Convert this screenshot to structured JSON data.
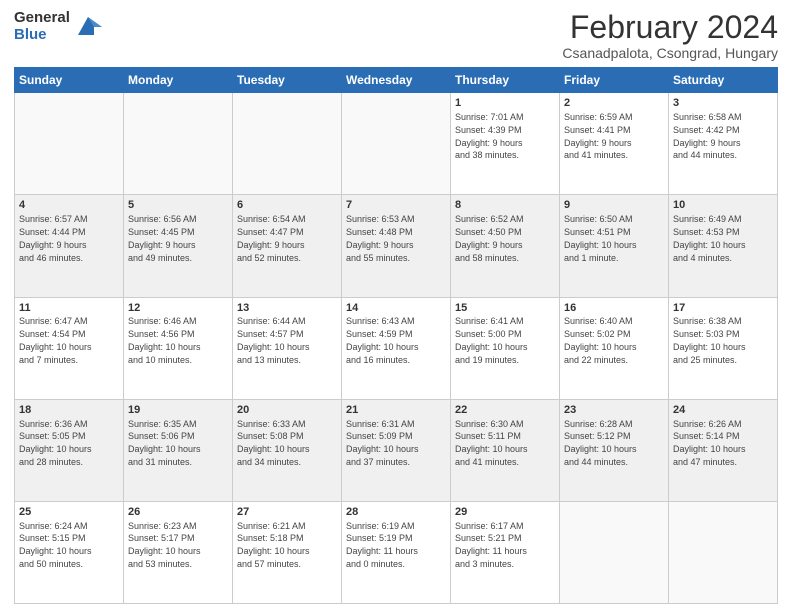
{
  "logo": {
    "general": "General",
    "blue": "Blue"
  },
  "header": {
    "month": "February 2024",
    "location": "Csanadpalota, Csongrad, Hungary"
  },
  "days_of_week": [
    "Sunday",
    "Monday",
    "Tuesday",
    "Wednesday",
    "Thursday",
    "Friday",
    "Saturday"
  ],
  "weeks": [
    [
      {
        "num": "",
        "info": ""
      },
      {
        "num": "",
        "info": ""
      },
      {
        "num": "",
        "info": ""
      },
      {
        "num": "",
        "info": ""
      },
      {
        "num": "1",
        "info": "Sunrise: 7:01 AM\nSunset: 4:39 PM\nDaylight: 9 hours\nand 38 minutes."
      },
      {
        "num": "2",
        "info": "Sunrise: 6:59 AM\nSunset: 4:41 PM\nDaylight: 9 hours\nand 41 minutes."
      },
      {
        "num": "3",
        "info": "Sunrise: 6:58 AM\nSunset: 4:42 PM\nDaylight: 9 hours\nand 44 minutes."
      }
    ],
    [
      {
        "num": "4",
        "info": "Sunrise: 6:57 AM\nSunset: 4:44 PM\nDaylight: 9 hours\nand 46 minutes."
      },
      {
        "num": "5",
        "info": "Sunrise: 6:56 AM\nSunset: 4:45 PM\nDaylight: 9 hours\nand 49 minutes."
      },
      {
        "num": "6",
        "info": "Sunrise: 6:54 AM\nSunset: 4:47 PM\nDaylight: 9 hours\nand 52 minutes."
      },
      {
        "num": "7",
        "info": "Sunrise: 6:53 AM\nSunset: 4:48 PM\nDaylight: 9 hours\nand 55 minutes."
      },
      {
        "num": "8",
        "info": "Sunrise: 6:52 AM\nSunset: 4:50 PM\nDaylight: 9 hours\nand 58 minutes."
      },
      {
        "num": "9",
        "info": "Sunrise: 6:50 AM\nSunset: 4:51 PM\nDaylight: 10 hours\nand 1 minute."
      },
      {
        "num": "10",
        "info": "Sunrise: 6:49 AM\nSunset: 4:53 PM\nDaylight: 10 hours\nand 4 minutes."
      }
    ],
    [
      {
        "num": "11",
        "info": "Sunrise: 6:47 AM\nSunset: 4:54 PM\nDaylight: 10 hours\nand 7 minutes."
      },
      {
        "num": "12",
        "info": "Sunrise: 6:46 AM\nSunset: 4:56 PM\nDaylight: 10 hours\nand 10 minutes."
      },
      {
        "num": "13",
        "info": "Sunrise: 6:44 AM\nSunset: 4:57 PM\nDaylight: 10 hours\nand 13 minutes."
      },
      {
        "num": "14",
        "info": "Sunrise: 6:43 AM\nSunset: 4:59 PM\nDaylight: 10 hours\nand 16 minutes."
      },
      {
        "num": "15",
        "info": "Sunrise: 6:41 AM\nSunset: 5:00 PM\nDaylight: 10 hours\nand 19 minutes."
      },
      {
        "num": "16",
        "info": "Sunrise: 6:40 AM\nSunset: 5:02 PM\nDaylight: 10 hours\nand 22 minutes."
      },
      {
        "num": "17",
        "info": "Sunrise: 6:38 AM\nSunset: 5:03 PM\nDaylight: 10 hours\nand 25 minutes."
      }
    ],
    [
      {
        "num": "18",
        "info": "Sunrise: 6:36 AM\nSunset: 5:05 PM\nDaylight: 10 hours\nand 28 minutes."
      },
      {
        "num": "19",
        "info": "Sunrise: 6:35 AM\nSunset: 5:06 PM\nDaylight: 10 hours\nand 31 minutes."
      },
      {
        "num": "20",
        "info": "Sunrise: 6:33 AM\nSunset: 5:08 PM\nDaylight: 10 hours\nand 34 minutes."
      },
      {
        "num": "21",
        "info": "Sunrise: 6:31 AM\nSunset: 5:09 PM\nDaylight: 10 hours\nand 37 minutes."
      },
      {
        "num": "22",
        "info": "Sunrise: 6:30 AM\nSunset: 5:11 PM\nDaylight: 10 hours\nand 41 minutes."
      },
      {
        "num": "23",
        "info": "Sunrise: 6:28 AM\nSunset: 5:12 PM\nDaylight: 10 hours\nand 44 minutes."
      },
      {
        "num": "24",
        "info": "Sunrise: 6:26 AM\nSunset: 5:14 PM\nDaylight: 10 hours\nand 47 minutes."
      }
    ],
    [
      {
        "num": "25",
        "info": "Sunrise: 6:24 AM\nSunset: 5:15 PM\nDaylight: 10 hours\nand 50 minutes."
      },
      {
        "num": "26",
        "info": "Sunrise: 6:23 AM\nSunset: 5:17 PM\nDaylight: 10 hours\nand 53 minutes."
      },
      {
        "num": "27",
        "info": "Sunrise: 6:21 AM\nSunset: 5:18 PM\nDaylight: 10 hours\nand 57 minutes."
      },
      {
        "num": "28",
        "info": "Sunrise: 6:19 AM\nSunset: 5:19 PM\nDaylight: 11 hours\nand 0 minutes."
      },
      {
        "num": "29",
        "info": "Sunrise: 6:17 AM\nSunset: 5:21 PM\nDaylight: 11 hours\nand 3 minutes."
      },
      {
        "num": "",
        "info": ""
      },
      {
        "num": "",
        "info": ""
      }
    ]
  ]
}
